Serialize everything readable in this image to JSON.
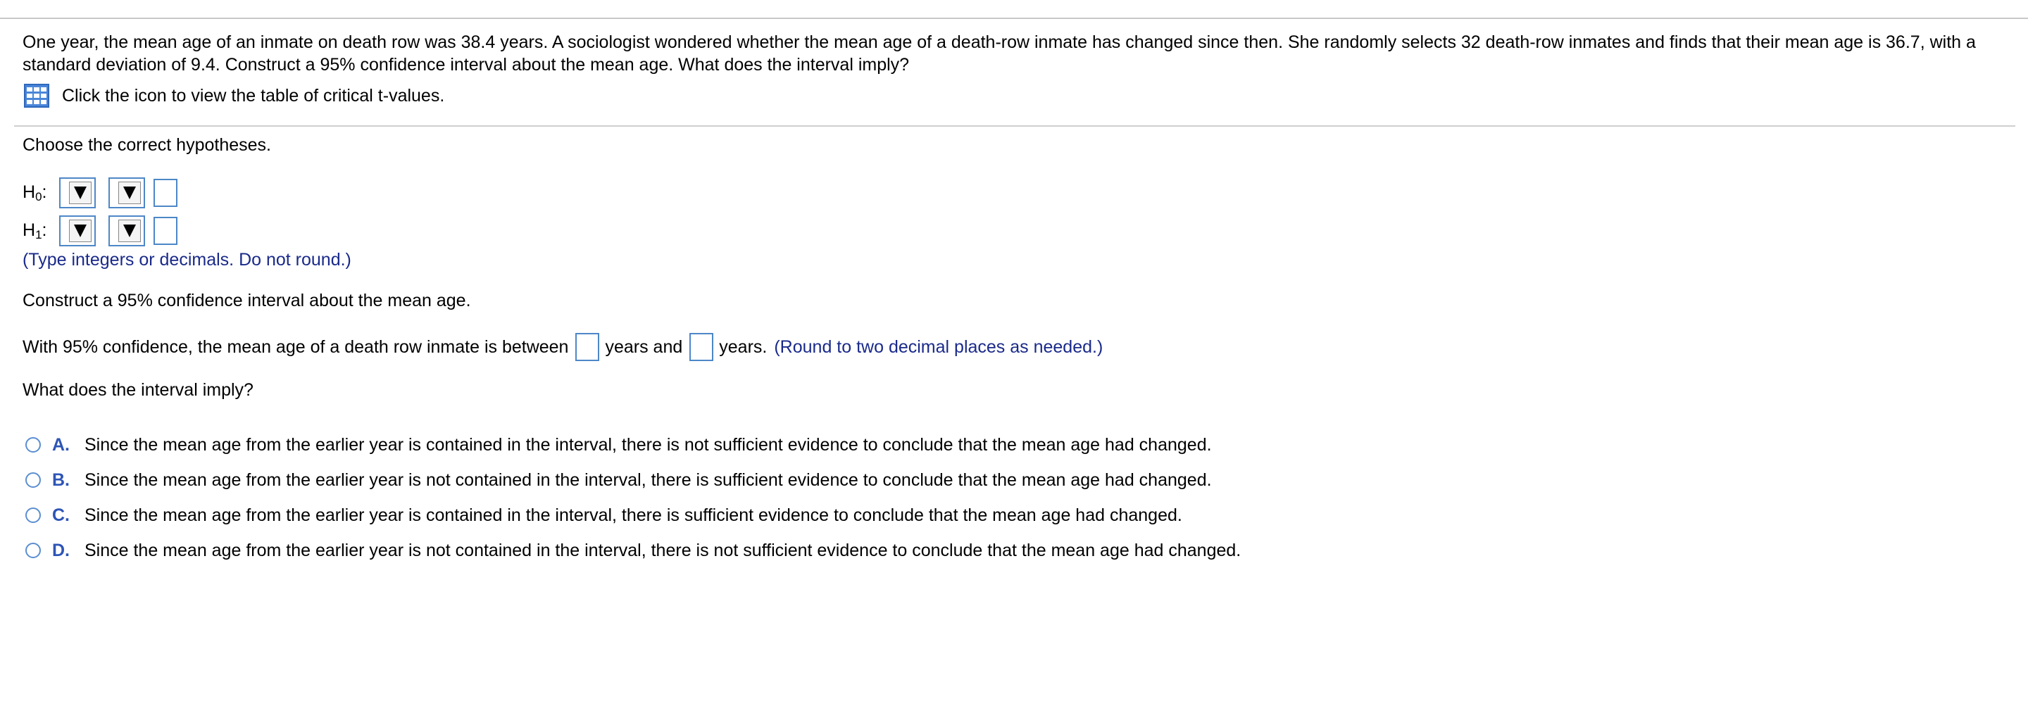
{
  "question": {
    "text": "One year, the mean age of an inmate on death row was 38.4 years. A sociologist wondered whether the mean age of a death-row inmate has changed since then. She randomly selects 32 death-row inmates and finds that their mean age is 36.7, with a standard deviation of 9.4. Construct a 95% confidence interval about the mean age. What does the interval imply?",
    "table_link": "Click the icon to view the table of critical t-values.",
    "table_icon": "table-icon"
  },
  "hypotheses": {
    "prompt": "Choose the correct hypotheses.",
    "h0_letter": "H",
    "h0_sub": "0",
    "h1_letter": "H",
    "h1_sub": "1",
    "colon": ":",
    "hint": "(Type integers or decimals. Do not round.)"
  },
  "interval": {
    "prompt": "Construct a 95% confidence interval about the mean age.",
    "sentence_start": "With 95% confidence, the mean age of a death row inmate is between",
    "sentence_mid": "years and",
    "sentence_end": "years.",
    "hint": "(Round to two decimal places as needed.)"
  },
  "implication": {
    "prompt": "What does the interval imply?",
    "options": [
      {
        "letter": "A.",
        "text": "Since the mean age from the earlier year is contained in the interval, there is not sufficient evidence to conclude that the mean age had changed."
      },
      {
        "letter": "B.",
        "text": "Since the mean age from the earlier year is not contained in the interval, there is sufficient evidence to conclude that the mean age had changed."
      },
      {
        "letter": "C.",
        "text": "Since the mean age from the earlier year is contained in the interval, there is sufficient evidence to conclude that the mean age had changed."
      },
      {
        "letter": "D.",
        "text": "Since the mean age from the earlier year is not contained in the interval, there is not sufficient evidence to conclude that the mean age had changed."
      }
    ]
  },
  "colors": {
    "accent_border": "#4d87c7",
    "hint_text": "#1a2a8a",
    "option_letter": "#2d55b5"
  }
}
